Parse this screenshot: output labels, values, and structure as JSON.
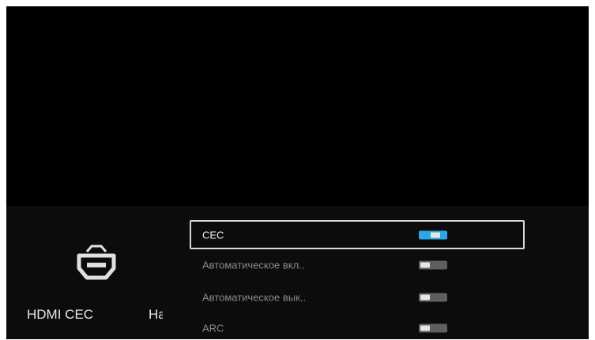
{
  "screen": {
    "section_title": "HDMI CEC",
    "section_title_2": "На",
    "icon": "hdmi-icon"
  },
  "menu": {
    "items": [
      {
        "label": "CEC",
        "toggle": "on",
        "selected": true
      },
      {
        "label": "Автоматическое вкл..",
        "toggle": "off",
        "selected": false
      },
      {
        "label": "Автоматическое вык..",
        "toggle": "off",
        "selected": false
      },
      {
        "label": "ARC",
        "toggle": "off",
        "selected": false
      }
    ]
  },
  "colors": {
    "background": "#000000",
    "panel": "#0c0c0c",
    "accent": "#2aa7e6",
    "toggle_off": "#5f5f5f",
    "text_active": "#f2f2f2",
    "text_inactive": "#8a8a8a"
  }
}
